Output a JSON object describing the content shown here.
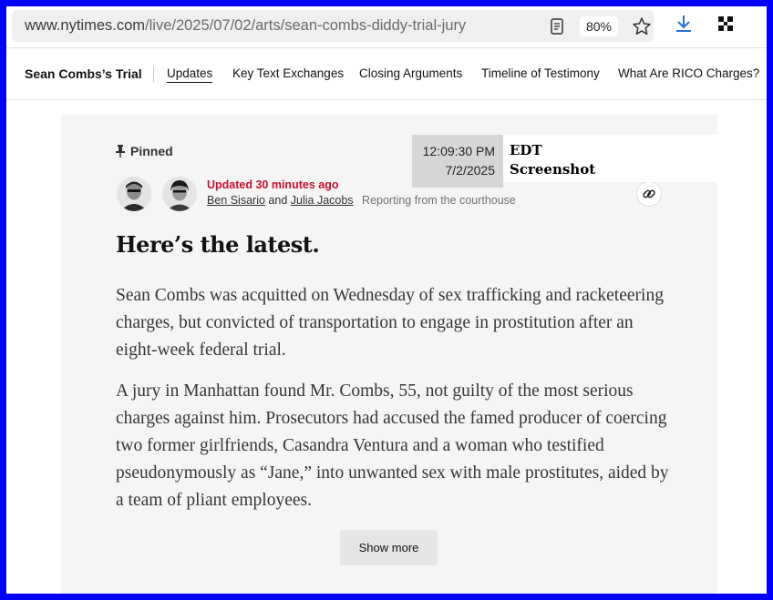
{
  "browser": {
    "url_host": "www.nytimes.com",
    "url_path": "/live/2025/07/02/arts/sean-combs-diddy-trial-jury",
    "zoom": "80%",
    "icons": [
      "reader-view-icon",
      "star-icon",
      "download-icon",
      "extensions-icon"
    ]
  },
  "nav": {
    "title": "Sean Combs’s Trial",
    "items": [
      {
        "label": "Updates",
        "active": true
      },
      {
        "label": "Key Text Exchanges"
      },
      {
        "label": "Closing Arguments"
      },
      {
        "label": "Timeline of Testimony"
      },
      {
        "label": "What Are RICO Charges?"
      }
    ]
  },
  "post": {
    "pinned": "Pinned",
    "updated": "Updated 30 minutes ago",
    "author1": "Ben Sisario",
    "and": "and",
    "author2": "Julia Jacobs",
    "location": "Reporting from the courthouse",
    "headline": "Here’s the latest.",
    "paragraphs": [
      "Sean Combs was acquitted on Wednesday of sex trafficking and racketeering charges, but convicted of transportation to engage in prostitution after an eight-week federal trial.",
      "A jury in Manhattan found Mr. Combs, 55, not guilty of the most serious charges against him. Prosecutors had accused the famed producer of coercing two former girlfriends, Casandra Ventura and a woman who testified pseudonymously as “Jane,” into unwanted sex with male prostitutes, aided by a team of pliant employees."
    ],
    "show_more": "Show more"
  },
  "stamp": {
    "time": "12:09:30 PM",
    "date": "7/2/2025",
    "label1": "EDT",
    "label2": "Screenshot"
  },
  "colors": {
    "frame": "#0000ff",
    "updated_red": "#c4122f",
    "card_bg": "#f5f5f5",
    "download_blue": "#2a6fd6"
  }
}
